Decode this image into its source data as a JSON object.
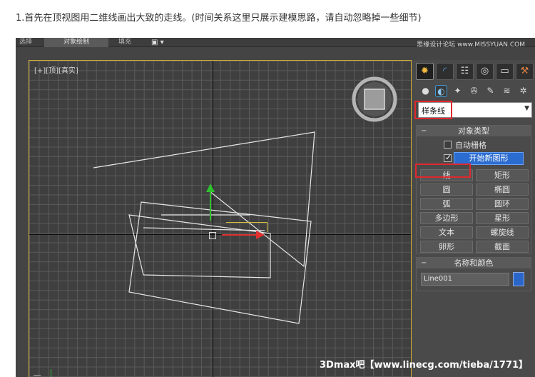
{
  "caption": "1.首先在顶视图用二维线画出大致的走线。(时间关系这里只展示建模思路，请自动忽略掉一些细节)",
  "tabs": {
    "tab0": "选择",
    "tab1": "对象绘制",
    "tab2": "填充",
    "tab_icon": "▣ ▾"
  },
  "watermark_top": "思缘设计论坛 www.MISSYUAN.COM",
  "watermark_bottom": "3Dmax吧【www.linecg.com/tieba/1771】",
  "viewport": {
    "label": "[+][顶][真实]"
  },
  "icons": {
    "row1": [
      "create-icon",
      "modify-icon",
      "hierarchy-icon",
      "motion-icon",
      "display-icon",
      "utilities-icon"
    ],
    "row2": [
      "geometry-icon",
      "shapes-icon",
      "lights-icon",
      "cameras-icon",
      "helpers-icon",
      "spacewarps-icon",
      "systems-icon"
    ]
  },
  "panel": {
    "dropdown_value": "样条线",
    "object_type": {
      "title": "对象类型",
      "auto_grid": "自动栅格",
      "start_new_shape": "开始新图形",
      "buttons": [
        "线",
        "矩形",
        "圆",
        "椭圆",
        "弧",
        "圆环",
        "多边形",
        "星形",
        "文本",
        "螺旋线",
        "卵形",
        "截面"
      ]
    },
    "name_color": {
      "title": "名称和颜色",
      "name": "Line001",
      "color": "#2a66c9"
    }
  },
  "colors": {
    "highlight": "#e0282d",
    "accent": "#2b6cd0",
    "axis_y": "#2fc02f",
    "axis_x": "#e03030"
  }
}
